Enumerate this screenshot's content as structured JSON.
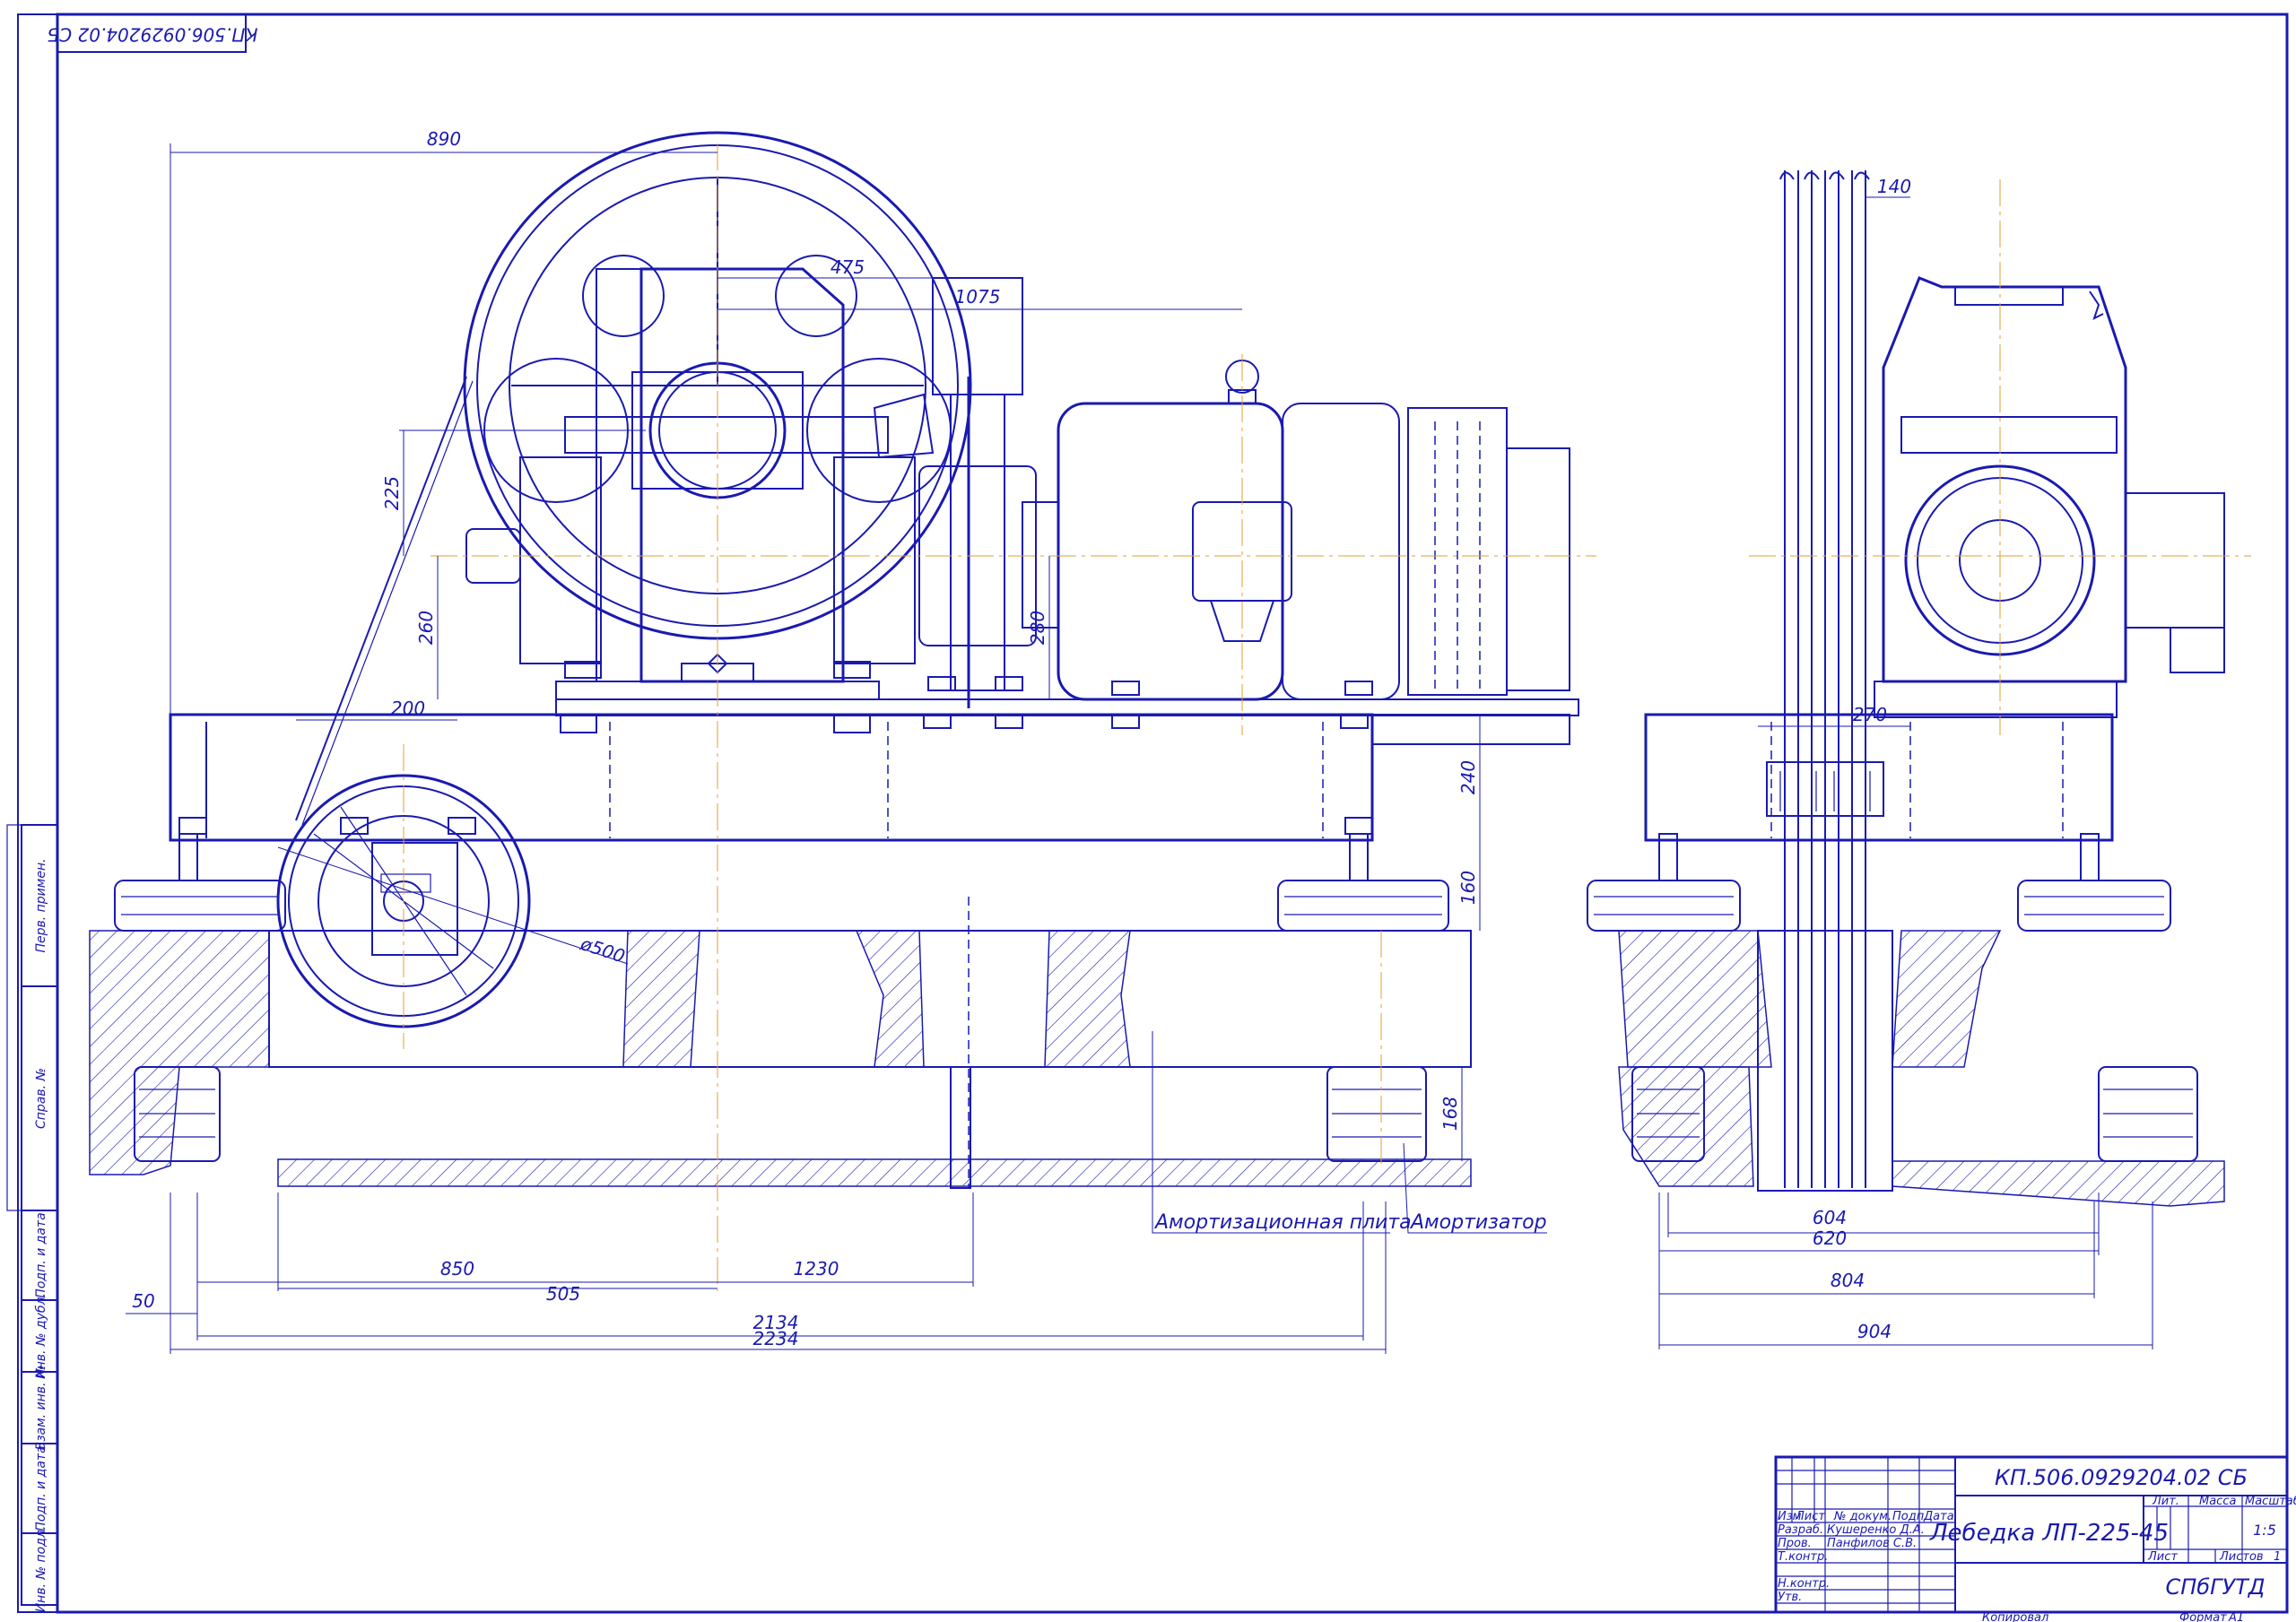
{
  "document": {
    "code": "КП.506.0929204.02 СБ",
    "code_rotated": "КП.506.0929204.02 СБ",
    "title": "Лебедка ЛП-225-45",
    "organization": "СПбГУТД",
    "scale": "1:5",
    "sheet_label": "Лист",
    "sheets_label": "Листов",
    "sheets_count": "1",
    "format_label": "Формат",
    "format": "A1",
    "copied_label": "Копировал"
  },
  "title_block": {
    "col_headers": [
      "Изм",
      "Лист",
      "№ докум.",
      "Подп.",
      "Дата"
    ],
    "rows": [
      {
        "role": "Разраб.",
        "name": "Кушеренко Д.А."
      },
      {
        "role": "Пров.",
        "name": "Панфилов С.В."
      },
      {
        "role": "Т.контр.",
        "name": ""
      },
      {
        "role": "Н.контр.",
        "name": ""
      },
      {
        "role": "Утв.",
        "name": ""
      }
    ],
    "lit_label": "Лит.",
    "mass_label": "Масса",
    "scale_label": "Масштаб"
  },
  "side_stamp": [
    "Перв. примен.",
    "Справ. №",
    "Подп. и дата",
    "Инв. № дубл.",
    "Взам. инв. №",
    "Подп. и дата",
    "Инв. № подл."
  ],
  "labels": {
    "plate": "Амортизационная плита",
    "absorber": "Амортизатор"
  },
  "dimensions": {
    "front": [
      "890",
      "475",
      "1075",
      "225",
      "260",
      "280",
      "200",
      "240",
      "160",
      "168",
      "ø500",
      "850",
      "505",
      "1230",
      "50",
      "2134",
      "2234"
    ],
    "side": [
      "140",
      "270",
      "604",
      "620",
      "804",
      "904"
    ]
  },
  "colors": {
    "line": "#1a1ab0",
    "axis": "#e0a030",
    "background": "#ffffff"
  }
}
